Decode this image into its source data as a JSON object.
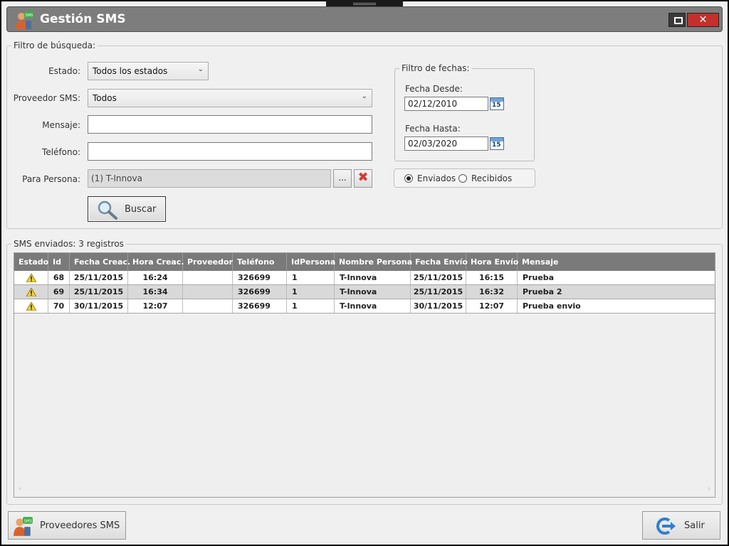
{
  "window": {
    "title": "Gestión SMS"
  },
  "filter": {
    "legend": "Filtro de búsqueda:",
    "estado_label": "Estado:",
    "estado_value": "Todos los estados",
    "proveedor_label": "Proveedor SMS:",
    "proveedor_value": "Todos",
    "mensaje_label": "Mensaje:",
    "mensaje_value": "",
    "telefono_label": "Teléfono:",
    "telefono_value": "",
    "persona_label": "Para Persona:",
    "persona_value": "(1) T-Innova",
    "browse_label": "...",
    "search_label": "Buscar"
  },
  "dates": {
    "legend": "Filtro de fechas:",
    "desde_label": "Fecha Desde:",
    "desde_value": "02/12/2010",
    "hasta_label": "Fecha Hasta:",
    "hasta_value": "02/03/2020",
    "calendar_day": "15"
  },
  "direction": {
    "enviados_label": "Enviados",
    "recibidos_label": "Recibidos",
    "selected": "enviados"
  },
  "results": {
    "legend": "SMS enviados: 3 registros",
    "columns": [
      "Estado",
      "Id",
      "Fecha Creac.",
      "Hora Creac.",
      "Proveedor",
      "Teléfono",
      "IdPersona",
      "Nombre Persona",
      "Fecha Envío",
      "Hora Envío",
      "Mensaje"
    ],
    "rows": [
      {
        "estado": "warning-icon",
        "id": "68",
        "fecha_creac": "25/11/2015",
        "hora_creac": "16:24",
        "proveedor": "",
        "telefono": "326699",
        "id_persona": "1",
        "nombre_persona": "T-Innova",
        "fecha_envio": "25/11/2015",
        "hora_envio": "16:15",
        "mensaje": "Prueba"
      },
      {
        "estado": "warning-icon",
        "id": "69",
        "fecha_creac": "25/11/2015",
        "hora_creac": "16:34",
        "proveedor": "",
        "telefono": "326699",
        "id_persona": "1",
        "nombre_persona": "T-Innova",
        "fecha_envio": "25/11/2015",
        "hora_envio": "16:32",
        "mensaje": "Prueba 2"
      },
      {
        "estado": "warning-icon",
        "id": "70",
        "fecha_creac": "30/11/2015",
        "hora_creac": "12:07",
        "proveedor": "",
        "telefono": "326699",
        "id_persona": "1",
        "nombre_persona": "T-Innova",
        "fecha_envio": "30/11/2015",
        "hora_envio": "12:07",
        "mensaje": "Prueba envio"
      }
    ],
    "scroll_left": "‹",
    "scroll_right": "›"
  },
  "footer": {
    "proveedores_label": "Proveedores SMS",
    "salir_label": "Salir"
  },
  "colors": {
    "titlebar": "#7d7d7d",
    "close_button": "#c4302b",
    "grid_header": "#7a7a7a",
    "warning": "#f2d22e",
    "delete_icon": "#d43a30"
  }
}
